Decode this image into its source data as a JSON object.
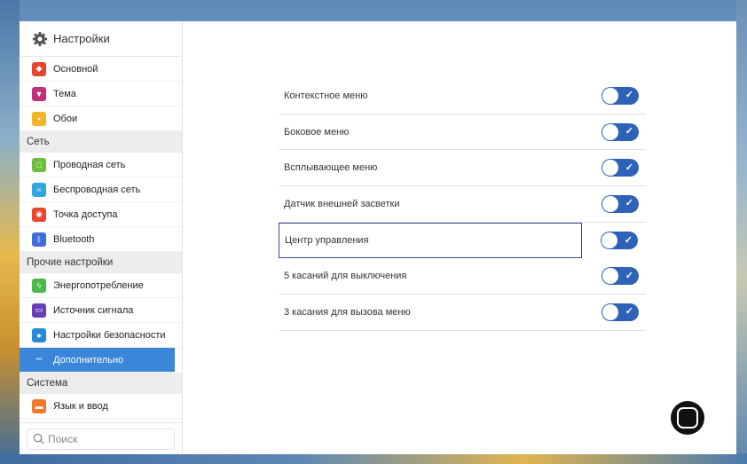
{
  "sidebar": {
    "title": "Настройки",
    "items": [
      {
        "type": "item",
        "label": "Основной",
        "icon": "shield-home-icon",
        "color": "#e8452f"
      },
      {
        "type": "item",
        "label": "Тема",
        "icon": "shirt-icon",
        "color": "#c0307a"
      },
      {
        "type": "item",
        "label": "Обои",
        "icon": "image-icon",
        "color": "#f0b428"
      },
      {
        "type": "section",
        "label": "Сеть"
      },
      {
        "type": "item",
        "label": "Проводная сеть",
        "icon": "ethernet-icon",
        "color": "#6cbf3c"
      },
      {
        "type": "item",
        "label": "Беспроводная сеть",
        "icon": "wifi-icon",
        "color": "#2fa8e0"
      },
      {
        "type": "item",
        "label": "Точка доступа",
        "icon": "hotspot-icon",
        "color": "#e8452f"
      },
      {
        "type": "item",
        "label": "Bluetooth",
        "icon": "bluetooth-icon",
        "color": "#3f6fd6"
      },
      {
        "type": "section",
        "label": "Прочие настройки"
      },
      {
        "type": "item",
        "label": "Энергопотребление",
        "icon": "battery-icon",
        "color": "#4bb84a"
      },
      {
        "type": "item",
        "label": "Источник сигнала",
        "icon": "monitor-icon",
        "color": "#6a3fb5"
      },
      {
        "type": "item",
        "label": "Настройки безопасности",
        "icon": "security-shield-icon",
        "color": "#2a8ad8"
      },
      {
        "type": "item",
        "label": "Дополнительно",
        "icon": "more-dots-icon",
        "color": "#3a86d8",
        "active": true
      },
      {
        "type": "section",
        "label": "Система"
      },
      {
        "type": "item",
        "label": "Язык и ввод",
        "icon": "keyboard-icon",
        "color": "#f07a2a"
      }
    ],
    "search_placeholder": "Поиск"
  },
  "main": {
    "settings": [
      {
        "label": "Контекстное меню",
        "enabled": true
      },
      {
        "label": "Боковое меню",
        "enabled": true
      },
      {
        "label": "Всплывающее меню",
        "enabled": true
      },
      {
        "label": "Датчик внешней засветки",
        "enabled": true
      },
      {
        "label": "Центр управления",
        "enabled": true,
        "focused": true
      },
      {
        "label": "5 касаний для выключения",
        "enabled": true
      },
      {
        "label": "3 касания для вызова меню",
        "enabled": true
      }
    ],
    "toggle_check": "✓"
  },
  "colors": {
    "accent": "#3a86d8",
    "toggle_on": "#2d62b8",
    "focus_border": "#3a4a88"
  }
}
